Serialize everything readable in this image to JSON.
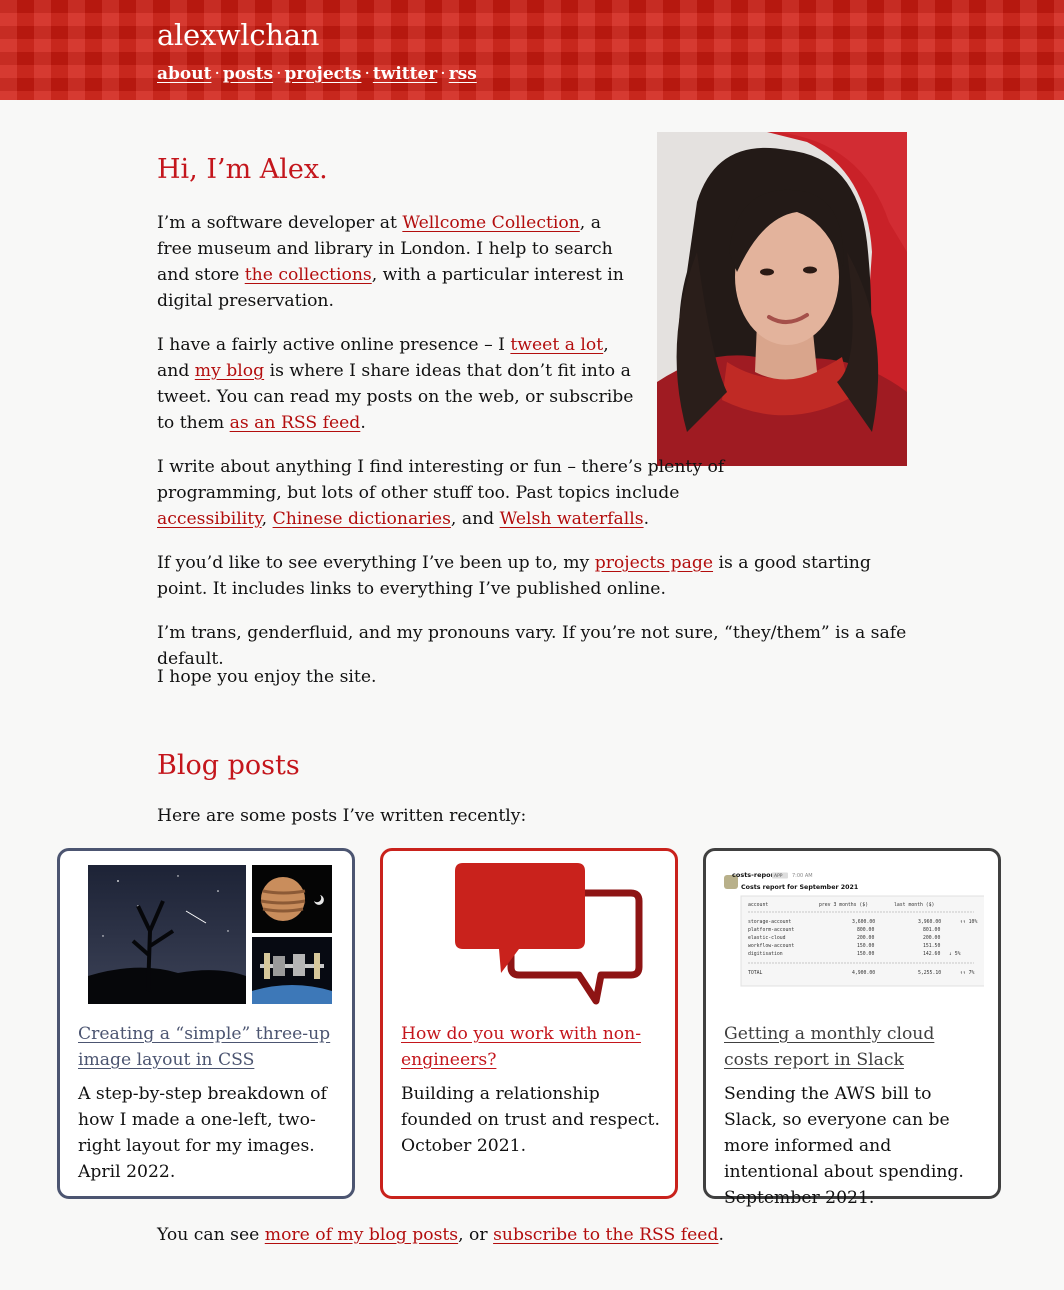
{
  "header": {
    "site_title": "alexwlchan",
    "nav": [
      {
        "label": "about"
      },
      {
        "label": "posts"
      },
      {
        "label": "projects"
      },
      {
        "label": "twitter"
      },
      {
        "label": "rss"
      }
    ],
    "separator": "·",
    "color": "#d01c11"
  },
  "intro": {
    "heading": "Hi, I’m Alex.",
    "p1": {
      "t1": "I’m a software developer at ",
      "link1": "Wellcome Collection",
      "t2": ", a free museum and library in London. I help to search and store ",
      "link2": "the collections",
      "t3": ", with a particular interest in digital preservation."
    },
    "p2": {
      "t1": "I have a fairly active online presence – I ",
      "link1": "tweet a lot",
      "t2": ", and ",
      "link2": "my blog",
      "t3": " is where I share ideas that don’t fit into a tweet. You can read my posts on the web, or subscribe to them ",
      "link3": "as an RSS feed",
      "t4": "."
    },
    "p3": {
      "t1": "I write about anything I find interesting or fun – there’s plenty of programming, but lots of other stuff too. Past topics include ",
      "link1": "accessibility",
      "t2": ", ",
      "link2": "Chinese dictionaries",
      "t3": ", and ",
      "link3": "Welsh waterfalls",
      "t4": "."
    },
    "p4": {
      "t1": "If you’d like to see everything I’ve been up to, my ",
      "link1": "projects page",
      "t2": " is a good starting point. It includes links to everything I’ve published online."
    },
    "p5": "I’m trans, genderfluid, and my pronouns vary. If you’re not sure, “they/them” is a safe default.",
    "p6": "I hope you enjoy the site."
  },
  "blog": {
    "heading": "Blog posts",
    "intro": "Here are some posts I’ve written recently:",
    "cards": [
      {
        "title": "Creating a “simple” three-up image layout in CSS",
        "description": "A step-by-step breakdown of how I made a one-left, two-right layout for my images.",
        "date": "April 2022.",
        "border_color": "#4c5571"
      },
      {
        "title": "How do you work with non-engineers?",
        "description": "Building a relationship founded on trust and respect.",
        "date": "October 2021.",
        "border_color": "#c9221c"
      },
      {
        "title": "Getting a monthly cloud costs report in Slack",
        "description": "Sending the AWS bill to Slack, so everyone can be more informed and intentional about spending.",
        "date": "September 2021.",
        "border_color": "#404040"
      }
    ],
    "slack": {
      "app_name": "costs-report",
      "app_badge": "APP",
      "time": "7:00 AM",
      "report_title": "Costs report for September 2021",
      "columns": [
        "account",
        "prev 3 months ($)",
        "last month ($)"
      ],
      "rows": [
        [
          "storage-account",
          "3,600.00",
          "3,960.00",
          "↑↑ 10%"
        ],
        [
          "platform-account",
          "800.00",
          "801.00",
          ""
        ],
        [
          "elastic-cloud",
          "200.00",
          "200.00",
          ""
        ],
        [
          "workflow-account",
          "150.00",
          "151.50",
          ""
        ],
        [
          "digitisation",
          "150.00",
          "142.60",
          "↓ 5%"
        ]
      ],
      "total": [
        "TOTAL",
        "4,900.00",
        "5,255.10",
        "↑↑ 7%"
      ]
    },
    "footer": {
      "t1": "You can see ",
      "link1": "more of my blog posts",
      "t2": ", or ",
      "link2": "subscribe to the RSS feed",
      "t3": "."
    }
  }
}
